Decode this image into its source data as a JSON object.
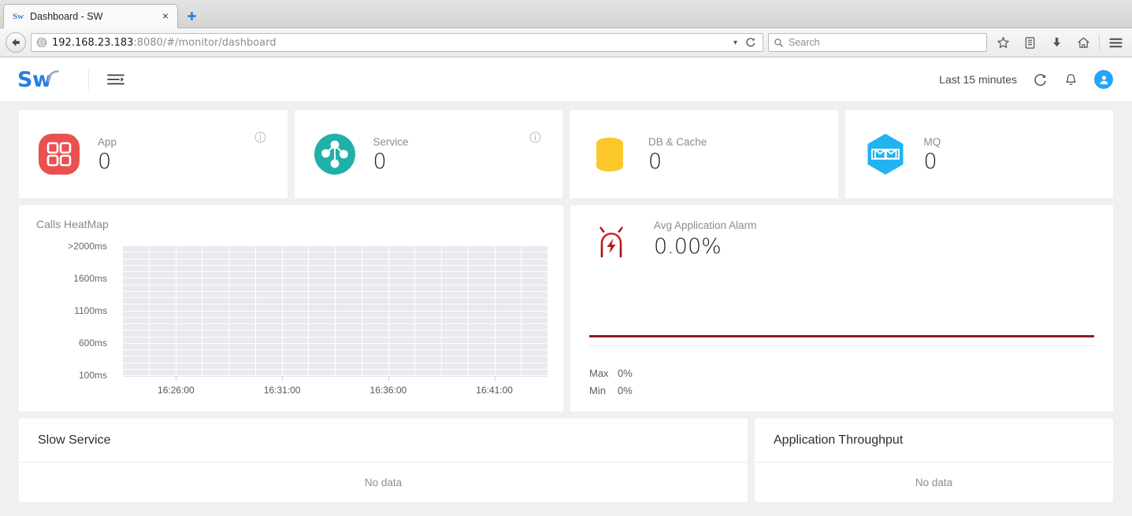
{
  "browser": {
    "tab": {
      "favicon_text": "Sw",
      "title": "Dashboard - SW",
      "close_label": "×"
    },
    "newtab_label": "+",
    "url": {
      "host": "192.168.23.183",
      "rest": ":8080/#/monitor/dashboard",
      "full": "192.168.23.183:8080/#/monitor/dashboard"
    },
    "search_placeholder": "Search",
    "icons": {
      "back": "back-arrow-icon",
      "globe": "globe-icon",
      "dropdown": "chevron-down-icon",
      "reload": "reload-icon",
      "search": "search-icon",
      "bookmark": "star-icon",
      "library": "library-icon",
      "downloads": "download-icon",
      "home": "home-icon",
      "menu": "hamburger-menu-icon"
    }
  },
  "app_header": {
    "logo_text": "Sw",
    "menu_toggle": "menu-indent-icon",
    "time_range": "Last 15 minutes",
    "refresh_icon": "refresh-icon",
    "bell_icon": "bell-icon",
    "avatar_icon": "user-avatar-icon"
  },
  "stats": [
    {
      "label": "App",
      "value": "0",
      "icon": "app-grid-icon",
      "color": "#e8514f",
      "has_info": true
    },
    {
      "label": "Service",
      "value": "0",
      "icon": "service-nodes-icon",
      "color": "#21b0a8",
      "has_info": true
    },
    {
      "label": "DB & Cache",
      "value": "0",
      "icon": "database-icon",
      "color": "#fcc728",
      "has_info": false
    },
    {
      "label": "MQ",
      "value": "0",
      "icon": "mq-hexagon-icon",
      "color": "#22b3f0",
      "has_info": false
    }
  ],
  "heatmap": {
    "title": "Calls HeatMap",
    "chart_data": {
      "type": "heatmap",
      "title": "Calls HeatMap",
      "xlabel": "",
      "ylabel": "",
      "y_tick_labels": [
        ">2000ms",
        "1600ms",
        "1100ms",
        "600ms",
        "100ms"
      ],
      "x_tick_labels": [
        "16:26:00",
        "16:31:00",
        "16:36:00",
        "16:41:00"
      ],
      "columns": 16,
      "rows": 20,
      "values": [],
      "empty_cell_color": "#e9e9ef",
      "grid": true,
      "legend": "none"
    }
  },
  "alarm": {
    "label": "Avg Application Alarm",
    "value": "0.00%",
    "icon": "alarm-siren-icon",
    "max_key": "Max",
    "max_value": "0%",
    "min_key": "Min",
    "min_value": "0%",
    "chart_data": {
      "type": "line",
      "title": "Avg Application Alarm",
      "series": [
        {
          "name": "Avg Application Alarm",
          "values": [
            0,
            0,
            0,
            0,
            0,
            0,
            0,
            0,
            0,
            0
          ]
        }
      ],
      "ylim": [
        0,
        0
      ],
      "ylabel": "%",
      "xlabel": "",
      "line_color": "#8c1f21",
      "grid": false,
      "legend": "none"
    }
  },
  "bottom_panels": [
    {
      "title": "Slow Service",
      "empty_text": "No data"
    },
    {
      "title": "Application Throughput",
      "empty_text": "No data"
    }
  ]
}
